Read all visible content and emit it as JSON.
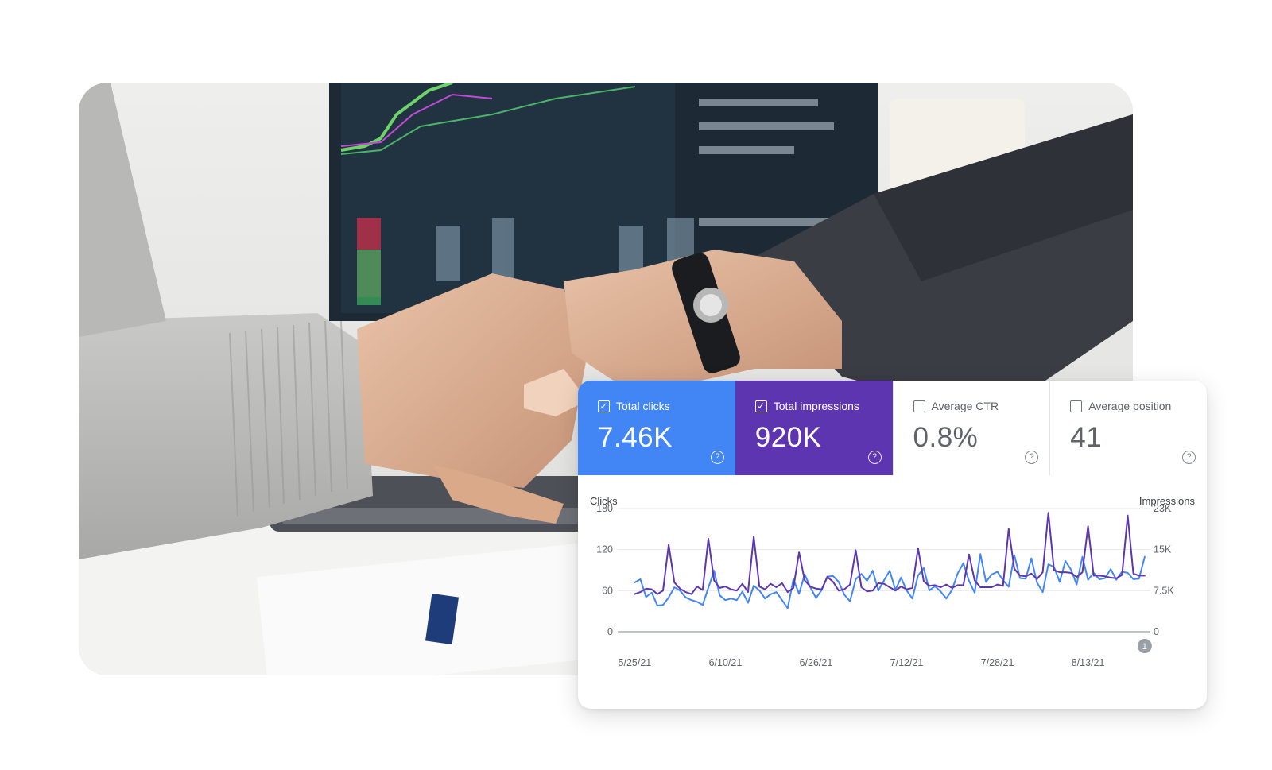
{
  "colors": {
    "clicks": "#4285f4",
    "impressions": "#5e35b1",
    "muted_text": "#5f6368",
    "grid": "#e8eaed",
    "baseline": "#9aa0a6"
  },
  "metrics": [
    {
      "label": "Total clicks",
      "value": "7.46K",
      "checked": true,
      "check_icon": "check-icon",
      "help_icon": "help-icon"
    },
    {
      "label": "Total impressions",
      "value": "920K",
      "checked": true,
      "check_icon": "check-icon",
      "help_icon": "help-icon"
    },
    {
      "label": "Average CTR",
      "value": "0.8%",
      "checked": false,
      "help_icon": "help-icon"
    },
    {
      "label": "Average position",
      "value": "41",
      "checked": false,
      "help_icon": "help-icon"
    }
  ],
  "chart_data": {
    "type": "line",
    "left_axis": {
      "title": "Clicks",
      "ticks": [
        "180",
        "120",
        "60",
        "0"
      ],
      "ylim": [
        0,
        180
      ]
    },
    "right_axis": {
      "title": "Impressions",
      "ticks": [
        "23K",
        "15K",
        "7.5K",
        "0"
      ],
      "ylim": [
        0,
        23000
      ]
    },
    "x_tick_labels": [
      "5/25/21",
      "6/10/21",
      "6/26/21",
      "7/12/21",
      "7/28/21",
      "8/13/21"
    ],
    "x_tick_days": [
      0,
      16,
      32,
      48,
      64,
      80
    ],
    "x_range_days": [
      -3,
      91
    ],
    "grid": true,
    "annotation": {
      "label": "1",
      "day": 90
    },
    "series": [
      {
        "name": "Impressions",
        "axis": "right",
        "color": "#4285f4",
        "x_days": [
          0,
          1,
          2,
          3,
          4,
          5,
          6,
          7,
          8,
          9,
          10,
          11,
          12,
          13,
          14,
          15,
          16,
          17,
          18,
          19,
          20,
          21,
          22,
          23,
          24,
          25,
          26,
          27,
          28,
          29,
          30,
          31,
          32,
          33,
          34,
          35,
          36,
          37,
          38,
          39,
          40,
          41,
          42,
          43,
          44,
          45,
          46,
          47,
          48,
          49,
          50,
          51,
          52,
          53,
          54,
          55,
          56,
          57,
          58,
          59,
          60,
          61,
          62,
          63,
          64,
          65,
          66,
          67,
          68,
          69,
          70,
          71,
          72,
          73,
          74,
          75,
          76,
          77,
          78,
          79,
          80,
          81,
          82,
          83,
          84,
          85,
          86,
          87,
          88,
          89,
          90
        ],
        "values": [
          9200,
          9800,
          6500,
          7300,
          4900,
          5000,
          6400,
          8300,
          7700,
          6400,
          5900,
          5600,
          5000,
          8200,
          11400,
          6800,
          5900,
          6200,
          5900,
          7500,
          5400,
          8600,
          7700,
          6200,
          7000,
          7400,
          5900,
          4400,
          9800,
          7100,
          10700,
          8300,
          6300,
          7800,
          10300,
          10400,
          9300,
          6900,
          5700,
          9800,
          10800,
          9500,
          11400,
          7700,
          9600,
          11400,
          7800,
          10100,
          7700,
          6200,
          10500,
          11900,
          7700,
          8500,
          7500,
          6200,
          7800,
          10900,
          12800,
          9500,
          7300,
          14500,
          9300,
          10700,
          11200,
          9600,
          8400,
          14300,
          10000,
          9900,
          13700,
          9200,
          7400,
          12600,
          12100,
          9300,
          13200,
          11600,
          8800,
          14000,
          9700,
          11000,
          9800,
          10000,
          11700,
          9700,
          11200,
          11000,
          9800,
          9900,
          14000
        ]
      },
      {
        "name": "Clicks",
        "axis": "left",
        "color": "#5e35b1",
        "x_days": [
          0,
          1,
          2,
          3,
          4,
          5,
          6,
          7,
          8,
          9,
          10,
          11,
          12,
          13,
          14,
          15,
          16,
          17,
          18,
          19,
          20,
          21,
          22,
          23,
          24,
          25,
          26,
          27,
          28,
          29,
          30,
          31,
          32,
          33,
          34,
          35,
          36,
          37,
          38,
          39,
          40,
          41,
          42,
          43,
          44,
          45,
          46,
          47,
          48,
          49,
          50,
          51,
          52,
          53,
          54,
          55,
          56,
          57,
          58,
          59,
          60,
          61,
          62,
          63,
          64,
          65,
          66,
          67,
          68,
          69,
          70,
          71,
          72,
          73,
          74,
          75,
          76,
          77,
          78,
          79,
          80,
          81,
          82,
          83,
          84,
          85,
          86,
          87,
          88,
          89,
          90
        ],
        "values": [
          55,
          58,
          63,
          62,
          55,
          60,
          127,
          72,
          63,
          58,
          55,
          66,
          61,
          136,
          75,
          64,
          66,
          62,
          60,
          70,
          58,
          139,
          66,
          62,
          70,
          65,
          71,
          58,
          64,
          116,
          75,
          66,
          63,
          62,
          80,
          73,
          60,
          62,
          69,
          119,
          65,
          59,
          60,
          71,
          70,
          65,
          60,
          66,
          62,
          64,
          122,
          74,
          67,
          68,
          65,
          69,
          64,
          68,
          68,
          113,
          75,
          65,
          65,
          65,
          69,
          67,
          150,
          92,
          82,
          81,
          85,
          77,
          87,
          174,
          90,
          87,
          87,
          86,
          80,
          87,
          154,
          82,
          82,
          81,
          79,
          78,
          83,
          170,
          85,
          82,
          82
        ]
      }
    ]
  }
}
